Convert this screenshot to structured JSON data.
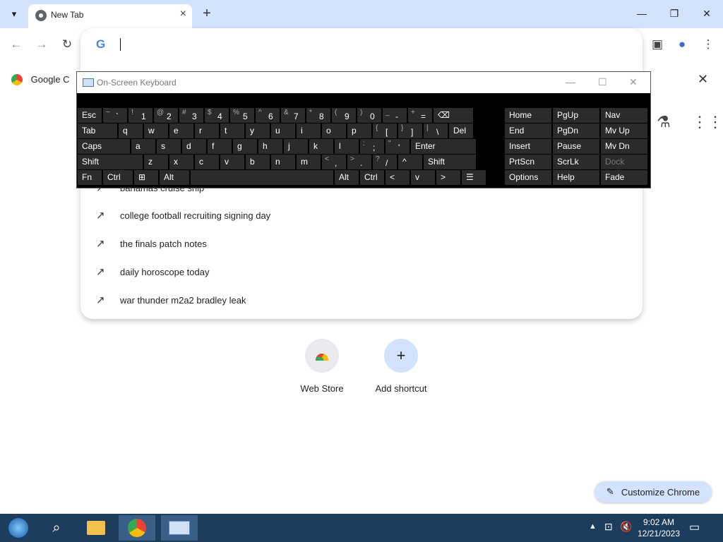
{
  "browser": {
    "tab_title": "New Tab",
    "new_tab_label": "+",
    "window_controls": {
      "minimize": "—",
      "restore": "❐",
      "close": "✕"
    }
  },
  "omnibox": {
    "value": "",
    "suggestions": [
      "bahamas cruise ship",
      "college football recruiting signing day",
      "the finals patch notes",
      "daily horoscope today",
      "war thunder m2a2 bradley leak"
    ]
  },
  "banner": {
    "text": "Google C"
  },
  "shortcuts": [
    {
      "label": "Web Store",
      "icon": "webstore-icon"
    },
    {
      "label": "Add shortcut",
      "icon": "plus-icon"
    }
  ],
  "customize_label": "Customize Chrome",
  "osk": {
    "title": "On-Screen Keyboard",
    "rows": [
      [
        {
          "s": "",
          "k": "Esc"
        },
        {
          "s": "~",
          "k": "`"
        },
        {
          "s": "!",
          "k": "1"
        },
        {
          "s": "@",
          "k": "2"
        },
        {
          "s": "#",
          "k": "3"
        },
        {
          "s": "$",
          "k": "4"
        },
        {
          "s": "%",
          "k": "5"
        },
        {
          "s": "^",
          "k": "6"
        },
        {
          "s": "&",
          "k": "7"
        },
        {
          "s": "*",
          "k": "8"
        },
        {
          "s": "(",
          "k": "9"
        },
        {
          "s": ")",
          "k": "0"
        },
        {
          "s": "_",
          "k": "-"
        },
        {
          "s": "+",
          "k": "="
        },
        {
          "s": "",
          "k": "⌫"
        }
      ],
      [
        {
          "s": "",
          "k": "Tab"
        },
        {
          "s": "",
          "k": "q"
        },
        {
          "s": "",
          "k": "w"
        },
        {
          "s": "",
          "k": "e"
        },
        {
          "s": "",
          "k": "r"
        },
        {
          "s": "",
          "k": "t"
        },
        {
          "s": "",
          "k": "y"
        },
        {
          "s": "",
          "k": "u"
        },
        {
          "s": "",
          "k": "i"
        },
        {
          "s": "",
          "k": "o"
        },
        {
          "s": "",
          "k": "p"
        },
        {
          "s": "{",
          "k": "["
        },
        {
          "s": "}",
          "k": "]"
        },
        {
          "s": "|",
          "k": "\\"
        },
        {
          "s": "",
          "k": "Del"
        }
      ],
      [
        {
          "s": "",
          "k": "Caps"
        },
        {
          "s": "",
          "k": "a"
        },
        {
          "s": "",
          "k": "s"
        },
        {
          "s": "",
          "k": "d"
        },
        {
          "s": "",
          "k": "f"
        },
        {
          "s": "",
          "k": "g"
        },
        {
          "s": "",
          "k": "h"
        },
        {
          "s": "",
          "k": "j"
        },
        {
          "s": "",
          "k": "k"
        },
        {
          "s": "",
          "k": "l"
        },
        {
          "s": ":",
          "k": ";"
        },
        {
          "s": "\"",
          "k": "'"
        },
        {
          "s": "",
          "k": "Enter"
        }
      ],
      [
        {
          "s": "",
          "k": "Shift"
        },
        {
          "s": "",
          "k": "z"
        },
        {
          "s": "",
          "k": "x"
        },
        {
          "s": "",
          "k": "c"
        },
        {
          "s": "",
          "k": "v"
        },
        {
          "s": "",
          "k": "b"
        },
        {
          "s": "",
          "k": "n"
        },
        {
          "s": "",
          "k": "m"
        },
        {
          "s": "<",
          "k": ","
        },
        {
          "s": ">",
          "k": "."
        },
        {
          "s": "?",
          "k": "/"
        },
        {
          "s": "",
          "k": "^"
        },
        {
          "s": "",
          "k": "Shift"
        }
      ],
      [
        {
          "s": "",
          "k": "Fn"
        },
        {
          "s": "",
          "k": "Ctrl"
        },
        {
          "s": "",
          "k": "⊞"
        },
        {
          "s": "",
          "k": "Alt"
        },
        {
          "s": "",
          "k": ""
        },
        {
          "s": "",
          "k": "Alt"
        },
        {
          "s": "",
          "k": "Ctrl"
        },
        {
          "s": "",
          "k": "<"
        },
        {
          "s": "",
          "k": "v"
        },
        {
          "s": "",
          "k": ">"
        },
        {
          "s": "",
          "k": "☰"
        }
      ]
    ],
    "right_keys": [
      [
        "Home",
        "PgUp",
        "Nav"
      ],
      [
        "End",
        "PgDn",
        "Mv Up"
      ],
      [
        "Insert",
        "Pause",
        "Mv Dn"
      ],
      [
        "PrtScn",
        "ScrLk",
        "Dock"
      ],
      [
        "Options",
        "Help",
        "Fade"
      ]
    ]
  },
  "taskbar": {
    "time": "9:02 AM",
    "date": "12/21/2023"
  }
}
